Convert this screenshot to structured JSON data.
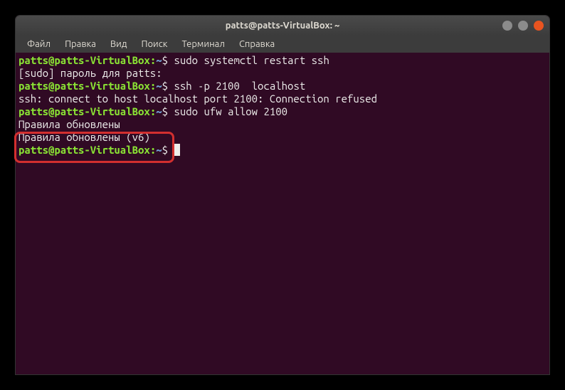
{
  "window": {
    "title": "patts@patts-VirtualBox: ~"
  },
  "menubar": {
    "items": [
      {
        "label": "Файл"
      },
      {
        "label": "Правка"
      },
      {
        "label": "Вид"
      },
      {
        "label": "Поиск"
      },
      {
        "label": "Терминал"
      },
      {
        "label": "Справка"
      }
    ]
  },
  "terminal": {
    "prompt_user": "patts@patts-VirtualBox",
    "prompt_path": "~",
    "prompt_sep": ":",
    "prompt_dollar": "$",
    "lines": [
      {
        "type": "cmd",
        "command": "sudo systemctl restart ssh"
      },
      {
        "type": "output",
        "text": "[sudo] пароль для patts:"
      },
      {
        "type": "cmd",
        "command": "ssh -p 2100  localhost"
      },
      {
        "type": "output",
        "text": "ssh: connect to host localhost port 2100: Connection refused"
      },
      {
        "type": "cmd",
        "command": "sudo ufw allow 2100"
      },
      {
        "type": "output",
        "text": "Правила обновлены"
      },
      {
        "type": "output",
        "text": "Правила обновлены (v6)"
      },
      {
        "type": "cmd",
        "command": ""
      }
    ]
  }
}
